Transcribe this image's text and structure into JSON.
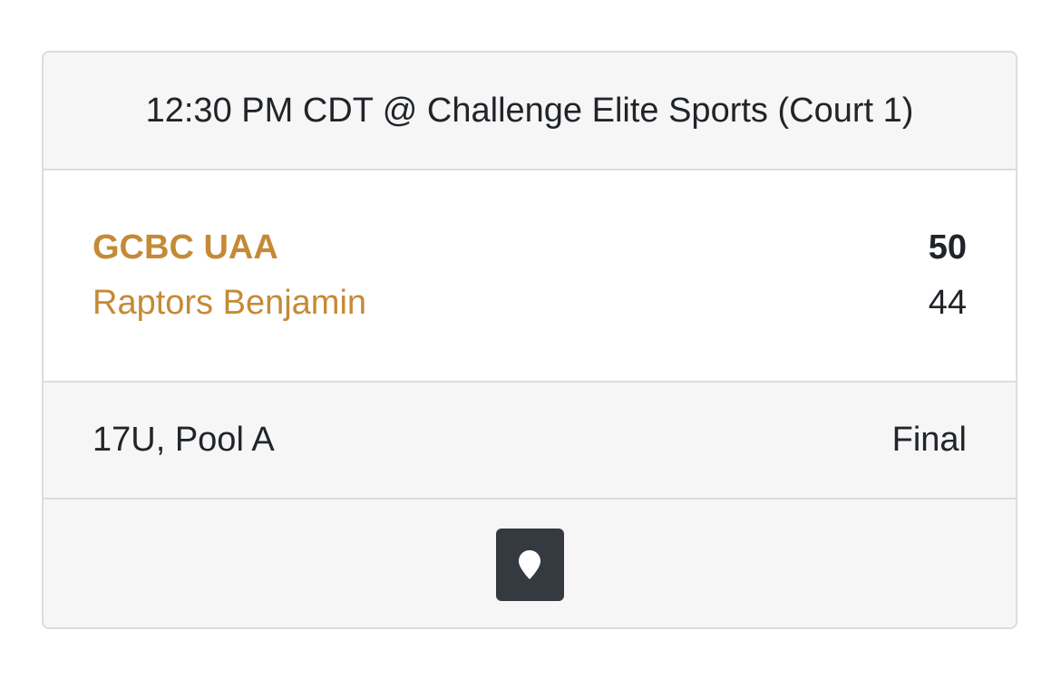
{
  "header": {
    "game_info": "12:30 PM CDT @ Challenge Elite Sports (Court 1)"
  },
  "teams": [
    {
      "name": "GCBC UAA",
      "score": "50"
    },
    {
      "name": "Raptors Benjamin",
      "score": "44"
    }
  ],
  "meta": {
    "division": "17U, Pool A",
    "status": "Final"
  },
  "footer": {
    "map_icon": "map-marker-icon"
  },
  "colors": {
    "team_link": "#c58a35",
    "header_bg": "#f6f6f6",
    "button_bg": "#343a40"
  }
}
